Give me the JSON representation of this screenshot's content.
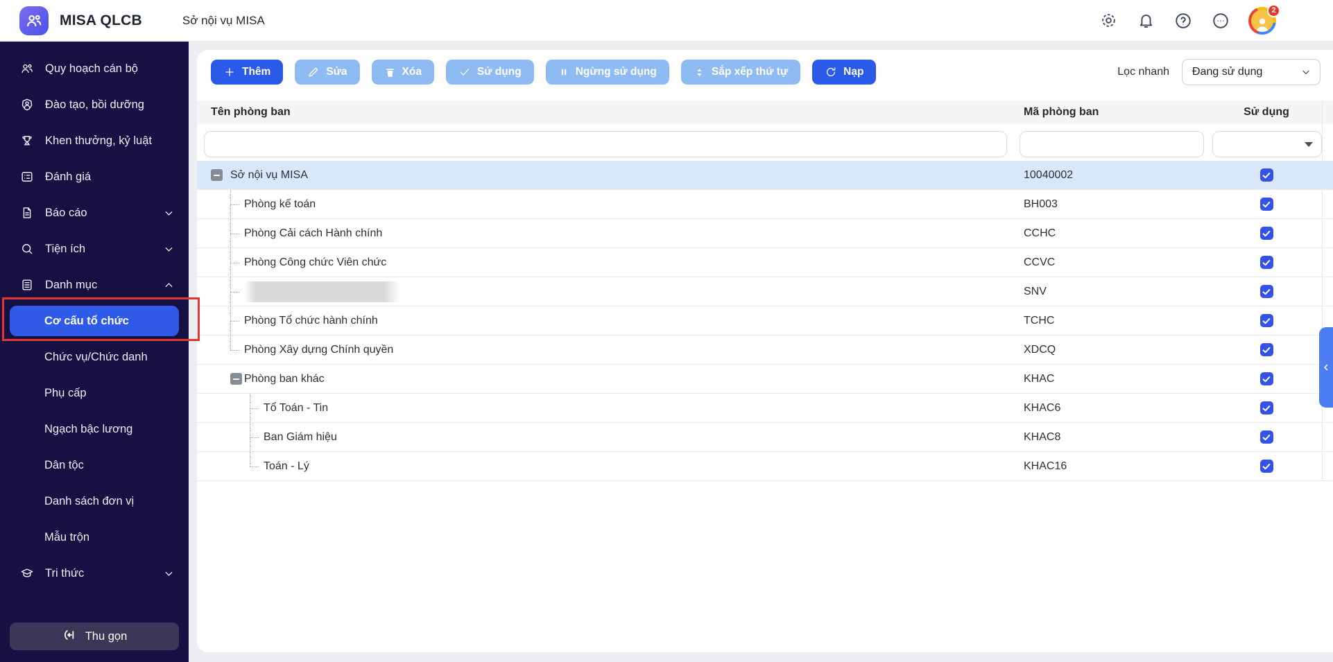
{
  "topbar": {
    "app_title": "MISA QLCB",
    "tab": "Sở nội vụ MISA",
    "icons": [
      {
        "name": "gear-icon"
      },
      {
        "name": "bell-icon"
      },
      {
        "name": "help-icon"
      },
      {
        "name": "more-icon"
      }
    ],
    "avatar_badge": "2"
  },
  "sidebar": {
    "items": [
      {
        "label": "Quy hoạch cán bộ",
        "icon": "people"
      },
      {
        "label": "Đào tạo, bồi dưỡng",
        "icon": "person-badge"
      },
      {
        "label": "Khen thưởng, kỷ luật",
        "icon": "trophy"
      },
      {
        "label": "Đánh giá",
        "icon": "checklist"
      },
      {
        "label": "Báo cáo",
        "icon": "report",
        "chevron": "down"
      },
      {
        "label": "Tiện ích",
        "icon": "search",
        "chevron": "down"
      },
      {
        "label": "Danh mục",
        "icon": "list",
        "chevron": "up"
      },
      {
        "label": "Cơ cấu tổ chức",
        "sub": true,
        "active": true,
        "annotated": true
      },
      {
        "label": "Chức vụ/Chức danh",
        "sub": true
      },
      {
        "label": "Phụ cấp",
        "sub": true
      },
      {
        "label": "Ngạch bậc lương",
        "sub": true
      },
      {
        "label": "Dân tộc",
        "sub": true
      },
      {
        "label": "Danh sách đơn vị",
        "sub": true
      },
      {
        "label": "Mẫu trộn",
        "sub": true
      },
      {
        "label": "Tri thức",
        "icon": "cap",
        "chevron": "down"
      }
    ],
    "collapse_label": "Thu gọn"
  },
  "toolbar": {
    "buttons": [
      {
        "label": "Thêm",
        "icon": "plus",
        "style": "primary"
      },
      {
        "label": "Sửa",
        "icon": "pencil",
        "style": "light"
      },
      {
        "label": "Xóa",
        "icon": "trash",
        "style": "light"
      },
      {
        "label": "Sử dụng",
        "icon": "check",
        "style": "light"
      },
      {
        "label": "Ngừng sử dụng",
        "icon": "pause",
        "style": "light"
      },
      {
        "label": "Sắp xếp thứ tự",
        "icon": "sort",
        "style": "light"
      },
      {
        "label": "Nạp",
        "icon": "refresh",
        "style": "primary"
      }
    ],
    "filter_label": "Lọc nhanh",
    "filter_value": "Đang sử dụng"
  },
  "table": {
    "columns": {
      "name": "Tên phòng ban",
      "code": "Mã phòng ban",
      "use": "Sử dụng"
    },
    "rows": [
      {
        "name": "Sở nội vụ MISA",
        "code": "10040002",
        "used": true,
        "level": 0,
        "expander": true,
        "selected": true
      },
      {
        "name": "Phòng kế toán",
        "code": "BH003",
        "used": true,
        "level": 1,
        "connector": true
      },
      {
        "name": "Phòng Cải cách Hành chính",
        "code": "CCHC",
        "used": true,
        "level": 1,
        "connector": true
      },
      {
        "name": "Phòng Công chức Viên chức",
        "code": "CCVC",
        "used": true,
        "level": 1,
        "connector": true
      },
      {
        "name": "",
        "code": "SNV",
        "used": true,
        "level": 1,
        "connector": true,
        "redacted": true
      },
      {
        "name": "Phòng Tổ chức hành chính",
        "code": "TCHC",
        "used": true,
        "level": 1,
        "connector": true
      },
      {
        "name": "Phòng Xây dựng Chính quyền",
        "code": "XDCQ",
        "used": true,
        "level": 1,
        "connector": true,
        "last": true
      },
      {
        "name": "Phòng ban khác",
        "code": "KHAC",
        "used": true,
        "level": 1,
        "expander": true
      },
      {
        "name": "Tổ Toán - Tin",
        "code": "KHAC6",
        "used": true,
        "level": 2,
        "connector": true
      },
      {
        "name": "Ban Giám hiệu",
        "code": "KHAC8",
        "used": true,
        "level": 2,
        "connector": true
      },
      {
        "name": "Toán - Lý",
        "code": "KHAC16",
        "used": true,
        "level": 2,
        "connector": true,
        "last": true
      }
    ]
  },
  "side_panel_toggle": {
    "chevron": "left"
  },
  "colors": {
    "primary_blue": "#2B59E8",
    "light_blue_button": "#8FBBF3",
    "sidebar_bg": "#161043",
    "selected_row": "#D9E7FB",
    "checkbox_blue": "#3452E8",
    "annotation_red": "#E4362C",
    "badge_red": "#E5372B"
  }
}
